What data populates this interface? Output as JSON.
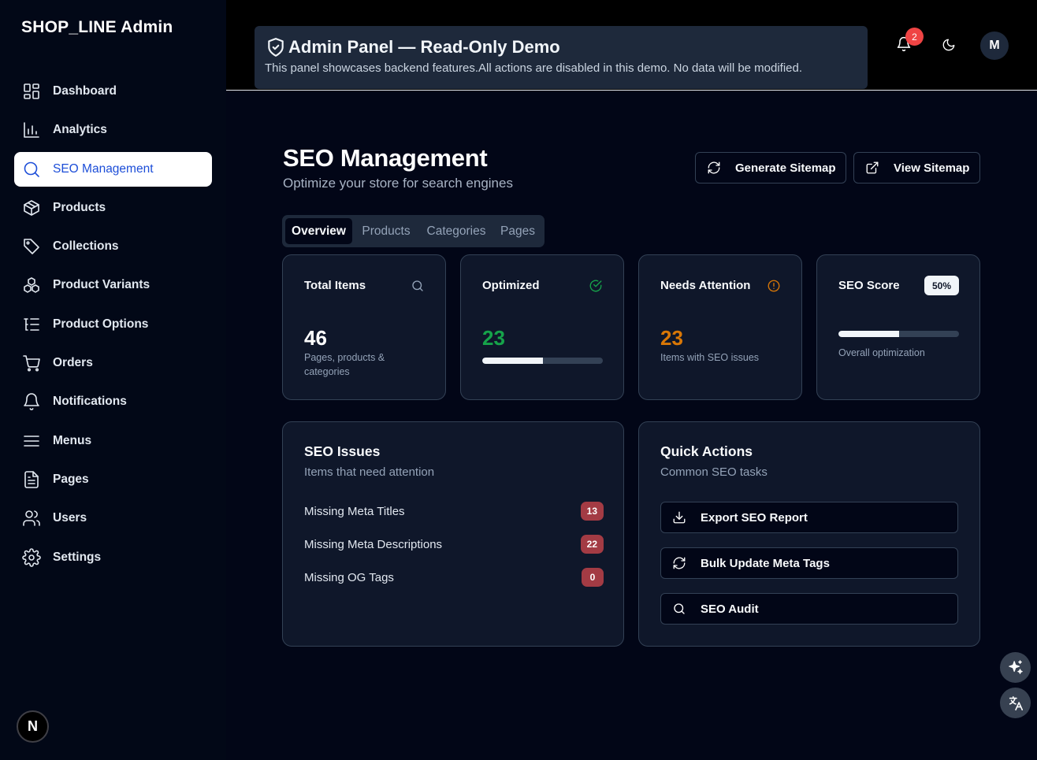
{
  "brand": "SHOP_LINE Admin",
  "nav": [
    {
      "label": "Dashboard",
      "icon": "dashboard-icon"
    },
    {
      "label": "Analytics",
      "icon": "bar-chart-icon"
    },
    {
      "label": "SEO Management",
      "icon": "search-icon",
      "active": true
    },
    {
      "label": "Products",
      "icon": "package-icon"
    },
    {
      "label": "Collections",
      "icon": "tag-icon"
    },
    {
      "label": "Product Variants",
      "icon": "boxes-icon"
    },
    {
      "label": "Product Options",
      "icon": "list-tree-icon"
    },
    {
      "label": "Orders",
      "icon": "cart-icon"
    },
    {
      "label": "Notifications",
      "icon": "bell-icon"
    },
    {
      "label": "Menus",
      "icon": "menu-icon"
    },
    {
      "label": "Pages",
      "icon": "file-icon"
    },
    {
      "label": "Users",
      "icon": "users-icon"
    },
    {
      "label": "Settings",
      "icon": "gear-icon"
    }
  ],
  "footer_badge": "N",
  "header": {
    "banner_title": "Admin Panel — Read-Only Demo",
    "banner_text": "This panel showcases backend features.All actions are disabled in this demo. No data will be modified.",
    "notification_count": "2",
    "avatar_initial": "M"
  },
  "page": {
    "title": "SEO Management",
    "subtitle": "Optimize your store for search engines",
    "generate_label": "Generate Sitemap",
    "view_label": "View Sitemap"
  },
  "tabs": [
    "Overview",
    "Products",
    "Categories",
    "Pages"
  ],
  "stats": {
    "total": {
      "label": "Total Items",
      "value": "46",
      "note": "Pages, products & categories"
    },
    "optimized": {
      "label": "Optimized",
      "value": "23",
      "progress": 0.5
    },
    "attention": {
      "label": "Needs Attention",
      "value": "23",
      "note": "Items with SEO issues"
    },
    "score": {
      "label": "SEO Score",
      "badge": "50%",
      "progress": 0.5,
      "note": "Overall optimization"
    }
  },
  "issues": {
    "title": "SEO Issues",
    "subtitle": "Items that need attention",
    "rows": [
      {
        "label": "Missing Meta Titles",
        "count": "13"
      },
      {
        "label": "Missing Meta Descriptions",
        "count": "22"
      },
      {
        "label": "Missing OG Tags",
        "count": "0"
      }
    ]
  },
  "quick_actions": {
    "title": "Quick Actions",
    "subtitle": "Common SEO tasks",
    "items": [
      "Export SEO Report",
      "Bulk Update Meta Tags",
      "SEO Audit"
    ]
  },
  "colors": {
    "accent": "#1d4ed8",
    "success": "#16a34a",
    "warning": "#d97706",
    "danger": "#a33b44"
  }
}
